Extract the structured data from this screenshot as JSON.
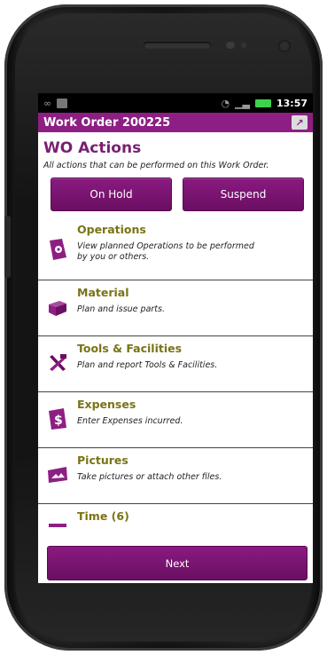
{
  "status_bar": {
    "time": "13:57"
  },
  "app": {
    "title": "Work Order 200225"
  },
  "page": {
    "heading": "WO Actions",
    "subheading": "All actions that can be performed on this Work Order."
  },
  "buttons": {
    "on_hold": "On Hold",
    "suspend": "Suspend",
    "next": "Next"
  },
  "actions": [
    {
      "label": "Operations",
      "description": "View planned Operations to be performed by you or others.",
      "icon": "gear-document-icon"
    },
    {
      "label": "Material",
      "description": "Plan and issue parts.",
      "icon": "box-icon"
    },
    {
      "label": "Tools & Facilities",
      "description": "Plan and report Tools & Facilities.",
      "icon": "tools-icon"
    },
    {
      "label": "Expenses",
      "description": "Enter Expenses incurred.",
      "icon": "dollar-document-icon"
    },
    {
      "label": "Pictures",
      "description": "Take pictures or attach other files.",
      "icon": "picture-icon"
    },
    {
      "label": "Time (6)",
      "description": "",
      "icon": "time-icon"
    }
  ],
  "colors": {
    "brand": "#8d1f84",
    "label": "#7a7316",
    "battery": "#3fd14b"
  }
}
